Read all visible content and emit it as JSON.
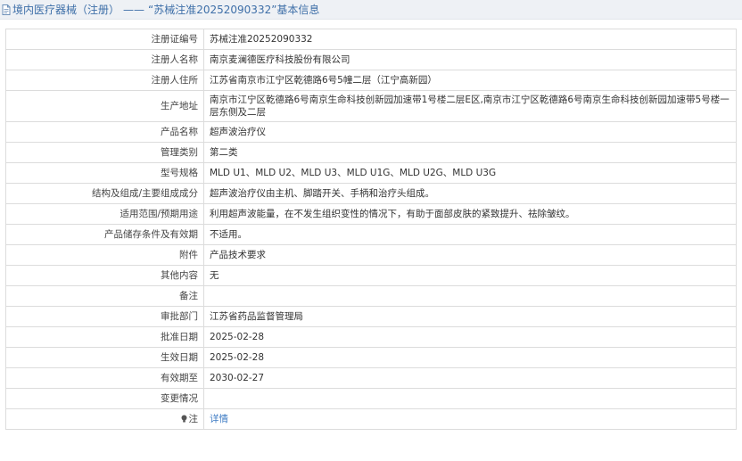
{
  "breadcrumb": {
    "section": "境内医疗器械（注册）",
    "separator": "——",
    "title": "“苏械注准20252090332”基本信息"
  },
  "rows": [
    {
      "label": "注册证编号",
      "value": "苏械注准20252090332"
    },
    {
      "label": "注册人名称",
      "value": "南京麦澜德医疗科技股份有限公司"
    },
    {
      "label": "注册人住所",
      "value": "江苏省南京市江宁区乾德路6号5幢二层（江宁高新园）"
    },
    {
      "label": "生产地址",
      "value": "南京市江宁区乾德路6号南京生命科技创新园加速带1号楼二层E区,南京市江宁区乾德路6号南京生命科技创新园加速带5号楼一层东侧及二层"
    },
    {
      "label": "产品名称",
      "value": "超声波治疗仪"
    },
    {
      "label": "管理类别",
      "value": "第二类"
    },
    {
      "label": "型号规格",
      "value": "MLD U1、MLD U2、MLD U3、MLD U1G、MLD U2G、MLD U3G"
    },
    {
      "label": "结构及组成/主要组成成分",
      "value": "超声波治疗仪由主机、脚踏开关、手柄和治疗头组成。"
    },
    {
      "label": "适用范围/预期用途",
      "value": "利用超声波能量，在不发生组织变性的情况下，有助于面部皮肤的紧致提升、祛除皱纹。"
    },
    {
      "label": "产品储存条件及有效期",
      "value": "不适用。"
    },
    {
      "label": "附件",
      "value": "产品技术要求"
    },
    {
      "label": "其他内容",
      "value": "无"
    },
    {
      "label": "备注",
      "value": ""
    },
    {
      "label": "审批部门",
      "value": "江苏省药品监督管理局"
    },
    {
      "label": "批准日期",
      "value": "2025-02-28"
    },
    {
      "label": "生效日期",
      "value": "2025-02-28"
    },
    {
      "label": "有效期至",
      "value": "2030-02-27"
    },
    {
      "label": "变更情况",
      "value": ""
    }
  ],
  "note_row": {
    "label": "注",
    "link_text": "详情"
  },
  "icons": {
    "breadcrumb": "document-icon",
    "note": "lightbulb-icon"
  },
  "colors": {
    "header_bg": "#eef1f5",
    "breadcrumb_text": "#3e6fa8",
    "link": "#3f7cc4",
    "border": "#dcdcdc"
  }
}
